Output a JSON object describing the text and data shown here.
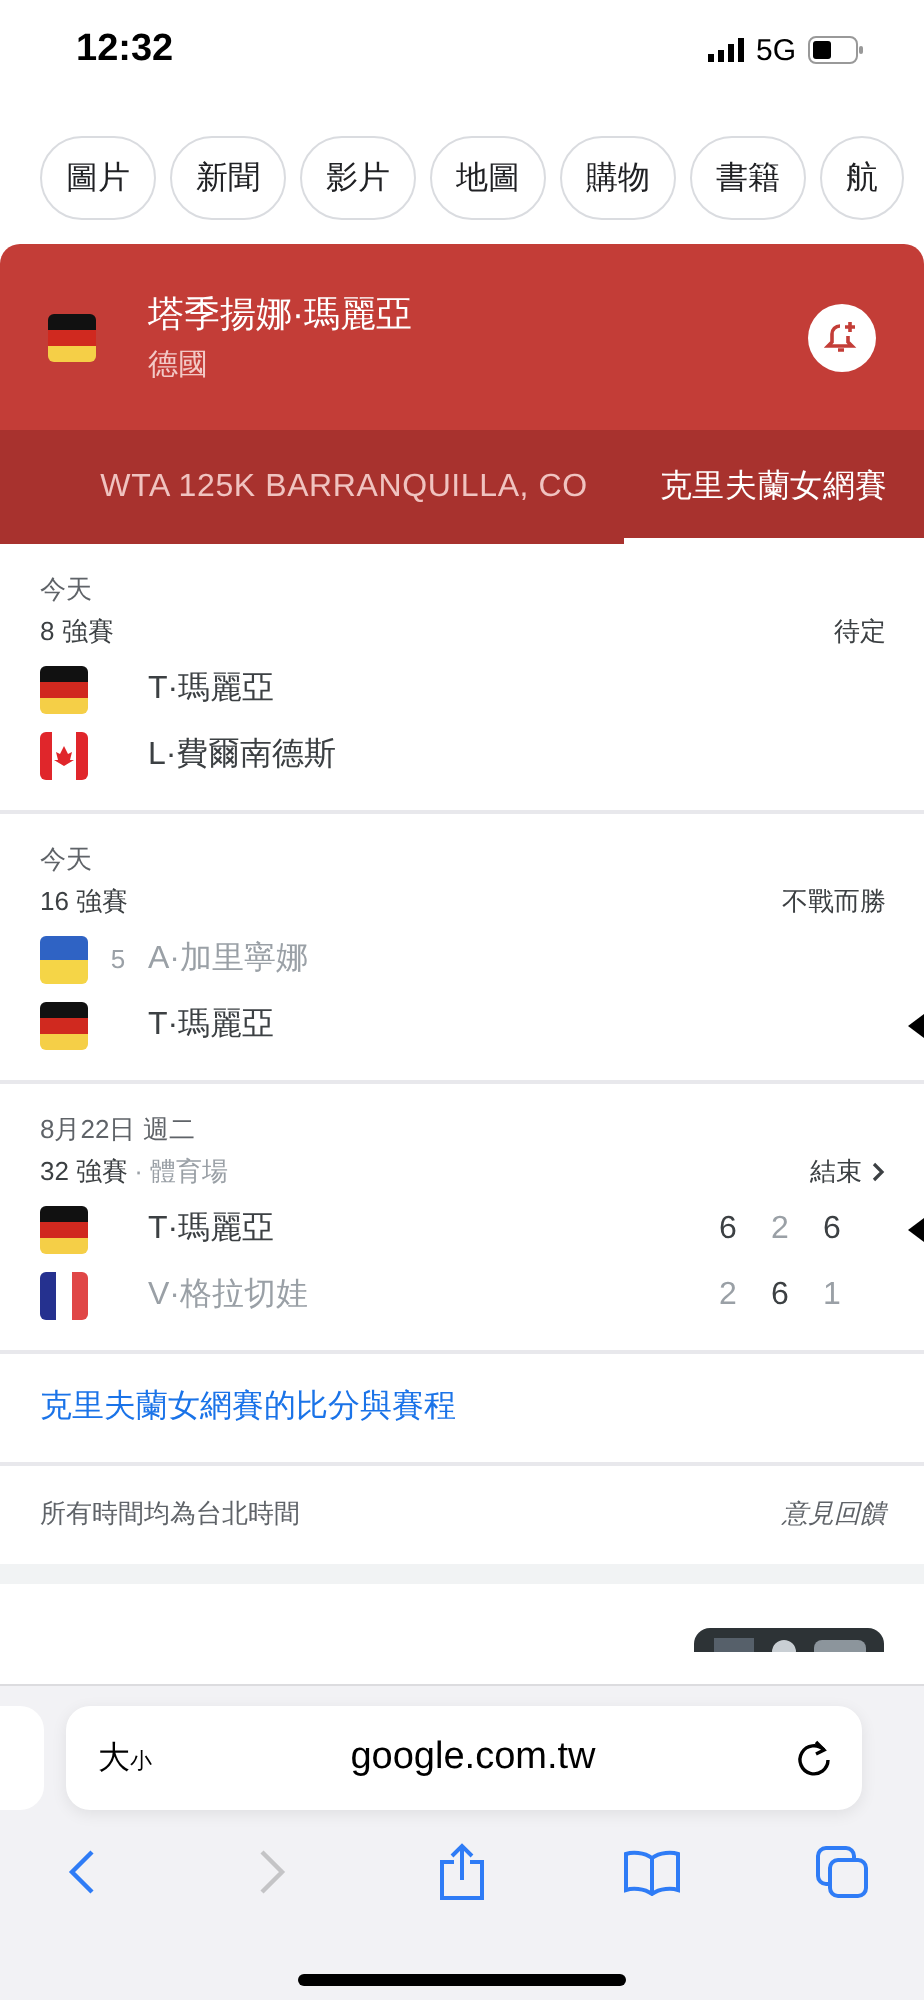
{
  "status_bar": {
    "time": "12:32",
    "network": "5G"
  },
  "chips": [
    {
      "label": "圖片"
    },
    {
      "label": "新聞"
    },
    {
      "label": "影片"
    },
    {
      "label": "地圖"
    },
    {
      "label": "購物"
    },
    {
      "label": "書籍"
    },
    {
      "label": "航"
    }
  ],
  "player_card": {
    "flag": {
      "kind": "germany"
    },
    "name": "塔季揚娜·瑪麗亞",
    "country": "德國"
  },
  "tabs": [
    {
      "label": "WTA 125K BARRANQUILLA, CO",
      "selected": false
    },
    {
      "label": "克里夫蘭女網賽",
      "selected": true
    }
  ],
  "matches": [
    {
      "date": "今天",
      "round": "8 強賽",
      "status": "待定",
      "status_link": false,
      "players": [
        {
          "flag": {
            "kind": "germany"
          },
          "name": "T·瑪麗亞",
          "dimmed": false,
          "winner": false
        },
        {
          "flag": {
            "kind": "canada"
          },
          "name": "L·費爾南德斯",
          "dimmed": false,
          "winner": false
        }
      ]
    },
    {
      "date": "今天",
      "round": "16 強賽",
      "status": "不戰而勝",
      "status_link": false,
      "players": [
        {
          "flag": {
            "kind": "ukraine"
          },
          "seed": "5",
          "name": "A·加里寧娜",
          "dimmed": true,
          "winner": false
        },
        {
          "flag": {
            "kind": "germany"
          },
          "name": "T·瑪麗亞",
          "dimmed": false,
          "winner": true
        }
      ]
    },
    {
      "date": "8月22日 週二",
      "round": "32 強賽",
      "venue": "· 體育場",
      "status": "結束",
      "status_link": true,
      "players": [
        {
          "flag": {
            "kind": "germany"
          },
          "name": "T·瑪麗亞",
          "dimmed": false,
          "winner": true,
          "scores": [
            {
              "value": "6",
              "won": true
            },
            {
              "value": "2",
              "won": false
            },
            {
              "value": "6",
              "won": true
            }
          ]
        },
        {
          "flag": {
            "kind": "france"
          },
          "name": "V·格拉切娃",
          "dimmed": true,
          "winner": false,
          "scores": [
            {
              "value": "2",
              "won": false
            },
            {
              "value": "6",
              "won": true
            },
            {
              "value": "1",
              "won": false
            }
          ]
        }
      ]
    }
  ],
  "more_link": "克里夫蘭女網賽的比分與賽程",
  "footer": {
    "note": "所有時間均為台北時間",
    "feedback": "意見回饋"
  },
  "browser": {
    "text_size": "大",
    "text_size_small": "小",
    "url": "google.com.tw"
  }
}
